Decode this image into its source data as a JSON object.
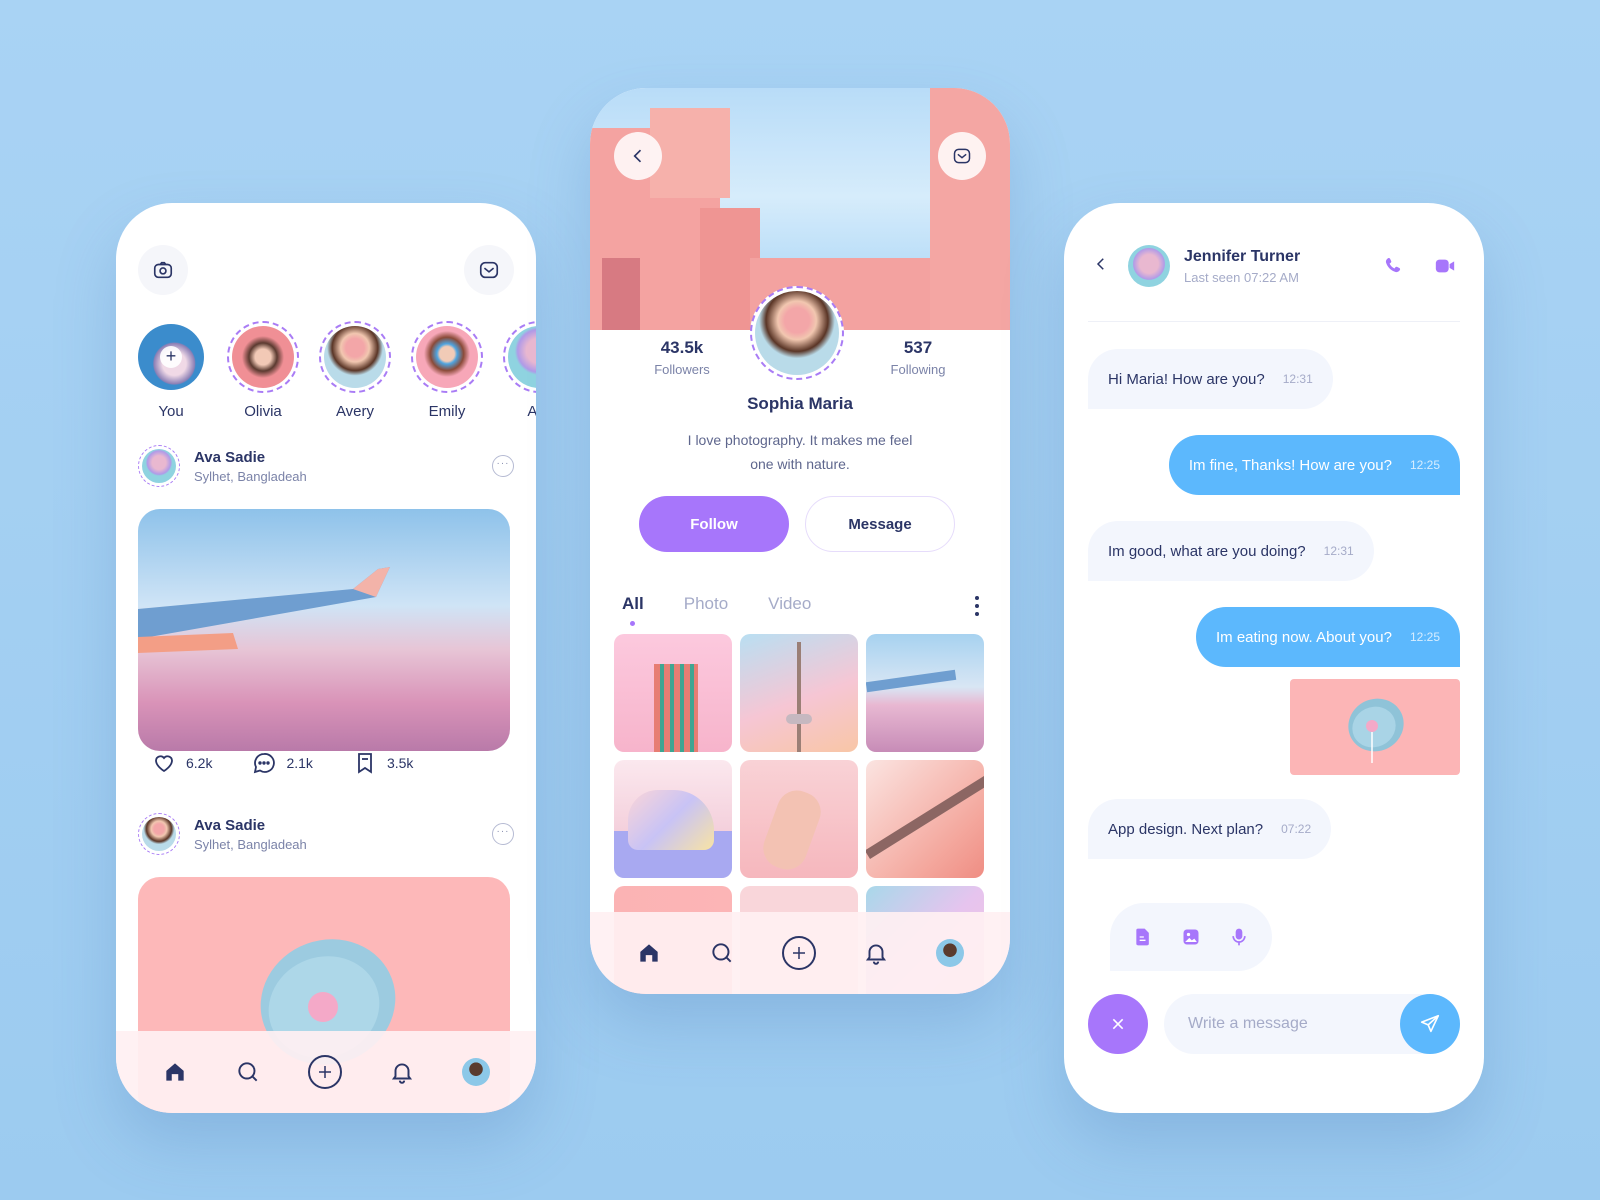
{
  "colors": {
    "accent_purple": "#a776fb",
    "accent_blue": "#5cb8fd",
    "text_dark": "#2b3566",
    "text_muted": "#7b83a8",
    "background": "#a9d3f4"
  },
  "feed": {
    "header_icons": [
      "camera-icon",
      "mail-icon"
    ],
    "stories": [
      {
        "label": "You",
        "is_self": true
      },
      {
        "label": "Olivia"
      },
      {
        "label": "Avery"
      },
      {
        "label": "Emily"
      },
      {
        "label": "Aur"
      }
    ],
    "posts": [
      {
        "author": "Ava Sadie",
        "location": "Sylhet, Bangladeah",
        "likes": "6.2k",
        "comments": "2.1k",
        "saves": "3.5k"
      },
      {
        "author": "Ava Sadie",
        "location": "Sylhet, Bangladeah"
      }
    ],
    "more_label": "···"
  },
  "profile": {
    "name": "Sophia Maria",
    "bio": "I love photography. It makes me feel one with nature.",
    "followers_count": "43.5k",
    "followers_label": "Followers",
    "following_count": "537",
    "following_label": "Following",
    "follow_button": "Follow",
    "message_button": "Message",
    "tabs": [
      {
        "label": "All",
        "active": true
      },
      {
        "label": "Photo",
        "active": false
      },
      {
        "label": "Video",
        "active": false
      }
    ]
  },
  "chat": {
    "contact_name": "Jennifer Turner",
    "last_seen": "Last seen 07:22 AM",
    "messages": [
      {
        "direction": "in",
        "text": "Hi Maria! How are you?",
        "time": "12:31"
      },
      {
        "direction": "out",
        "text": "Im fine, Thanks! How are you?",
        "time": "12:25"
      },
      {
        "direction": "in",
        "text": "Im good, what are you doing?",
        "time": "12:31"
      },
      {
        "direction": "out",
        "text": "Im eating now. About you?",
        "time": "12:25"
      },
      {
        "direction": "out",
        "type": "image"
      },
      {
        "direction": "in",
        "text": "App design. Next plan?",
        "time": "07:22"
      }
    ],
    "input_placeholder": "Write a message",
    "input_value": ""
  },
  "nav": [
    "home-icon",
    "search-icon",
    "add-icon",
    "bell-icon",
    "profile-avatar"
  ]
}
